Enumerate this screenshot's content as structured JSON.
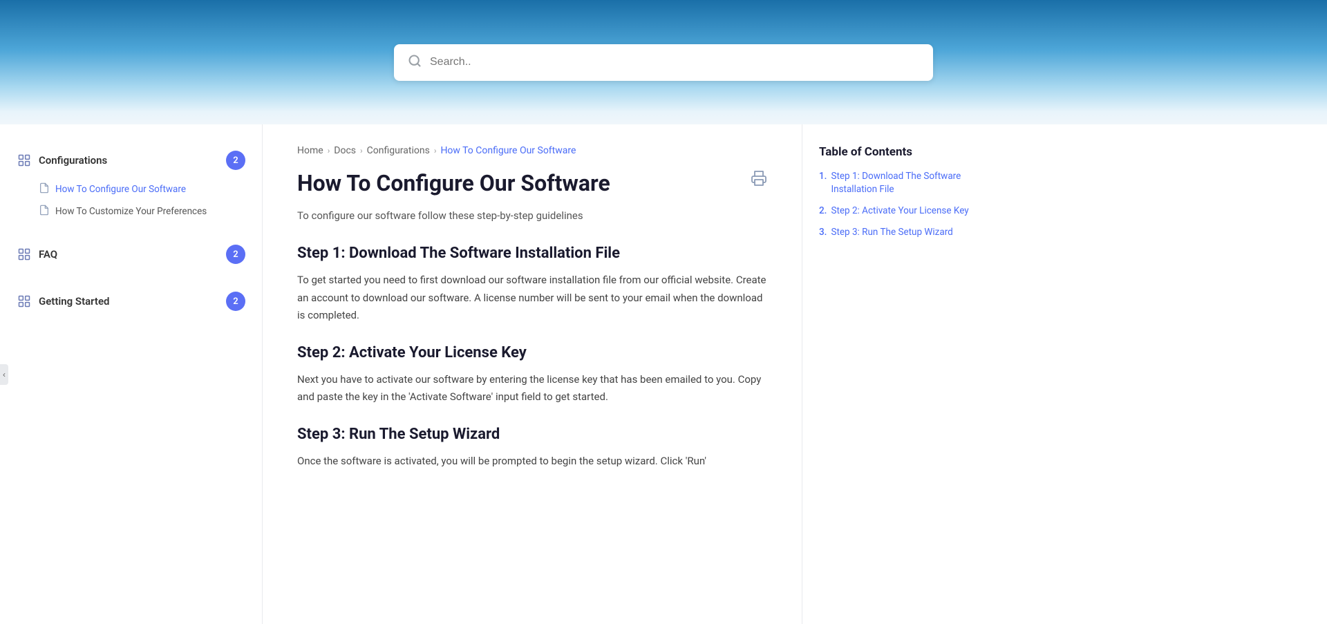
{
  "header": {
    "search_placeholder": "Search.."
  },
  "sidebar": {
    "toggle_icon": "‹",
    "sections": [
      {
        "id": "configurations",
        "label": "Configurations",
        "badge": "2",
        "sub_items": [
          {
            "id": "how-to-configure",
            "label": "How To Configure Our Software",
            "active": true
          },
          {
            "id": "how-to-customize",
            "label": "How To Customize Your Preferences",
            "active": false
          }
        ]
      },
      {
        "id": "faq",
        "label": "FAQ",
        "badge": "2",
        "sub_items": []
      },
      {
        "id": "getting-started",
        "label": "Getting Started",
        "badge": "2",
        "sub_items": []
      }
    ]
  },
  "breadcrumb": {
    "items": [
      "Home",
      "Docs",
      "Configurations",
      "How To Configure Our Software"
    ],
    "active_index": 3
  },
  "content": {
    "page_title": "How To Configure Our Software",
    "intro": "To configure our software follow these step-by-step guidelines",
    "sections": [
      {
        "id": "step1",
        "title": "Step 1: Download The Software Installation File",
        "text": "To get started you need to first download our software installation file from our official website. Create an account to download our software. A license number will be sent to your email when the download is completed."
      },
      {
        "id": "step2",
        "title": "Step 2: Activate Your License Key",
        "text": "Next you have to activate our software by entering the license key that has been emailed to you. Copy and paste the key in the 'Activate Software' input field to get started."
      },
      {
        "id": "step3",
        "title": "Step 3: Run The Setup Wizard",
        "text": "Once the software is activated, you will be prompted to begin the setup wizard. Click 'Run'"
      }
    ]
  },
  "toc": {
    "title": "Table of Contents",
    "items": [
      {
        "number": "1.",
        "label": "Step 1: Download The Software Installation File"
      },
      {
        "number": "2.",
        "label": "Step 2: Activate Your License Key"
      },
      {
        "number": "3.",
        "label": "Step 3: Run The Setup Wizard"
      }
    ]
  }
}
